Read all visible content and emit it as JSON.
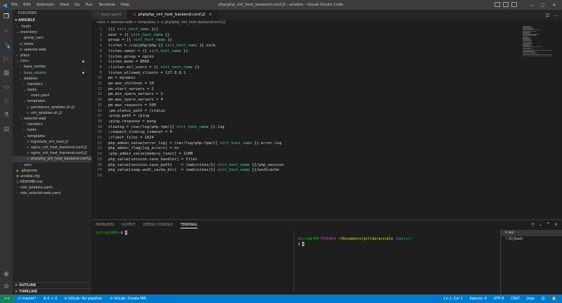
{
  "titlebar": {
    "menu": [
      "File",
      "Edit",
      "Selection",
      "View",
      "Go",
      "Run",
      "Terminal",
      "Help"
    ],
    "title": "php\\php_virt_host_backend.conf.j2 - ansible - Visual Studio Code"
  },
  "sidebar": {
    "title": "EXPLORER",
    "workspace": "ANSIBLE",
    "tree": [
      {
        "depth": 1,
        "chev": ">",
        "label": ".hosts"
      },
      {
        "depth": 1,
        "chev": "v",
        "label": "inventory"
      },
      {
        "depth": 2,
        "chev": ">",
        "label": "group_vars"
      },
      {
        "depth": 2,
        "chev": "",
        "label": "hosts",
        "icon": "≡"
      },
      {
        "depth": 2,
        "chev": "",
        "label": "selectel-web",
        "icon": "≡"
      },
      {
        "depth": 1,
        "chev": ">",
        "label": "plays"
      },
      {
        "depth": 1,
        "chev": "v",
        "label": "roles",
        "green": true,
        "dot": true
      },
      {
        "depth": 2,
        "chev": ">",
        "label": "base_centos"
      },
      {
        "depth": 2,
        "chev": ">",
        "label": "base_ubuntu",
        "green": true,
        "dot": true
      },
      {
        "depth": 2,
        "chev": "v",
        "label": "iptables"
      },
      {
        "depth": 3,
        "chev": ">",
        "label": "handlers"
      },
      {
        "depth": 3,
        "chev": "v",
        "label": "tasks"
      },
      {
        "depth": 4,
        "chev": "",
        "label": "main.yaml",
        "icon": "!",
        "iconcls": "c-yml"
      },
      {
        "depth": 3,
        "chev": "v",
        "label": "templates"
      },
      {
        "depth": 4,
        "chev": "",
        "label": "persitence_iptables.sh.j2",
        "icon": "≡",
        "iconcls": "c-j2"
      },
      {
        "depth": 4,
        "chev": "",
        "label": "virt_iptables.sh.j2",
        "icon": "≡",
        "iconcls": "c-j2"
      },
      {
        "depth": 2,
        "chev": "v",
        "label": "selectel-web"
      },
      {
        "depth": 3,
        "chev": ">",
        "label": "handlers"
      },
      {
        "depth": 3,
        "chev": ">",
        "label": "tasks"
      },
      {
        "depth": 3,
        "chev": "v",
        "label": "templates"
      },
      {
        "depth": 4,
        "chev": "",
        "label": "logrotate_virt_host.j2",
        "icon": "≡",
        "iconcls": "c-j2"
      },
      {
        "depth": 4,
        "chev": "",
        "label": "nginx_virt_host_backend.conf.j2",
        "icon": "≡",
        "iconcls": "c-j2"
      },
      {
        "depth": 4,
        "chev": "",
        "label": "nginx_virt_host_frontend.conf.j2",
        "icon": "≡",
        "iconcls": "c-j2"
      },
      {
        "depth": 4,
        "chev": "",
        "label": "php\\php_virt_host_backend.conf.j2",
        "icon": "≡",
        "iconcls": "c-j2",
        "selected": true
      },
      {
        "depth": 2,
        "chev": ">",
        "label": "vars"
      },
      {
        "depth": 1,
        "chev": "",
        "label": ".gitignore",
        "icon": "◆",
        "iconcls": "c-red"
      },
      {
        "depth": 1,
        "chev": "",
        "label": "ansible.cfg",
        "icon": "⚙"
      },
      {
        "depth": 1,
        "chev": "",
        "label": "README.md",
        "icon": "ⓘ"
      },
      {
        "depth": 1,
        "chev": "",
        "label": "role_iptables.yaml",
        "icon": "!",
        "iconcls": "c-yml"
      },
      {
        "depth": 1,
        "chev": "",
        "label": "role_selectel-web.yaml",
        "icon": "!",
        "iconcls": "c-yml"
      }
    ],
    "outline": "OUTLINE",
    "timeline": "TIMELINE"
  },
  "tabs": [
    {
      "label": "main.yaml",
      "icon": "!",
      "active": false
    },
    {
      "label": "php\\php_virt_host_backend.conf.j2",
      "icon": "≡",
      "active": true,
      "close": "×"
    }
  ],
  "breadcrumb": "roles > selectel-web > templates > ≡ php\\php_virt_host_backend.conf.j2",
  "editor": {
    "lines": [
      {
        "n": "1",
        "pre": "[{{ ",
        "var": "virt_host_name",
        "post": " }}]"
      },
      {
        "n": "2",
        "pre": "user = {{ ",
        "var": "virt_host_name",
        "post": " }}"
      },
      {
        "n": "3",
        "pre": "group = {{ ",
        "var": "virt_host_name",
        "post": " }}"
      },
      {
        "n": "4",
        "pre": "listen = /run/php/php-{{ ",
        "var": "virt_host_name",
        "post": " }}.sock"
      },
      {
        "n": "5",
        "pre": "listen.owner = {{ ",
        "var": "virt_host_name",
        "post": " }}"
      },
      {
        "n": "6",
        "pre": "listen.group = nginx",
        "var": "",
        "post": ""
      },
      {
        "n": "7",
        "pre": "listen.mode = 0660",
        "var": "",
        "post": ""
      },
      {
        "n": "8",
        "pre": ";listen.acl_users = {{ ",
        "var": "virt_host_name",
        "post": " }}"
      },
      {
        "n": "9",
        "pre": "listen.allowed_clients = 127.0.0.1",
        "var": "",
        "post": ""
      },
      {
        "n": "10",
        "pre": "pm = dynamic",
        "var": "",
        "post": ""
      },
      {
        "n": "11",
        "pre": "pm.max_children = 10",
        "var": "",
        "post": ""
      },
      {
        "n": "12",
        "pre": "pm.start_servers = 2",
        "var": "",
        "post": ""
      },
      {
        "n": "13",
        "pre": "pm.min_spare_servers = 2",
        "var": "",
        "post": ""
      },
      {
        "n": "14",
        "pre": "pm.max_spare_servers = 4",
        "var": "",
        "post": ""
      },
      {
        "n": "15",
        "pre": "pm.max_requests = 500",
        "var": "",
        "post": ""
      },
      {
        "n": "16",
        "pre": ";pm.status_path = /status",
        "var": "",
        "post": ""
      },
      {
        "n": "17",
        "pre": ";ping.path = /ping",
        "var": "",
        "post": ""
      },
      {
        "n": "18",
        "pre": ";ping.response = pong",
        "var": "",
        "post": ""
      },
      {
        "n": "19",
        "pre": "slowlog = /var/log/php-fpm/{{ ",
        "var": "virt_host_name",
        "post": " }}.log"
      },
      {
        "n": "20",
        "pre": ";request_slowlog_timeout = 0",
        "var": "",
        "post": ""
      },
      {
        "n": "21",
        "pre": ";rlimit_files = 1024",
        "var": "",
        "post": ""
      },
      {
        "n": "22",
        "pre": "php_admin_value[error_log] = /var/log/php-fpm/{{ ",
        "var": "virt_host_name",
        "post": " }}-error.log"
      },
      {
        "n": "23",
        "pre": "php_admin_flag[log_errors] = on",
        "var": "",
        "post": ""
      },
      {
        "n": "24",
        "pre": ";php_admin_value[memory_limit] = 128M",
        "var": "",
        "post": ""
      },
      {
        "n": "25",
        "pre": "php_value[session.save_handler] = files",
        "var": "",
        "post": ""
      },
      {
        "n": "26",
        "pre": "php_value[session.save_path]    = /web/sites/{{ ",
        "var": "virt_host_name",
        "post": " }}/php_session"
      },
      {
        "n": "27",
        "pre": "php_value[soap.wsdl_cache_dir]  = /web/sites/{{ ",
        "var": "virt_host_name",
        "post": " }}/wsdlcache"
      },
      {
        "n": "28",
        "pre": "",
        "var": "",
        "post": ""
      }
    ]
  },
  "panel": {
    "tabs": [
      "PROBLEMS",
      "OUTPUT",
      "DEBUG CONSOLE",
      "TERMINAL"
    ],
    "active_tab": "TERMINAL",
    "term_left": {
      "user": "zorro@1400",
      "rest": ":~$ "
    },
    "term_right": {
      "user": "Zorro@1400",
      "host": " MINGW64 ",
      "path": "~/Documents/gitlab/ansible",
      "branch": " (master)",
      "prompt": "$ "
    },
    "terminals": [
      {
        "label": "wsl",
        "icon": "⌷"
      },
      {
        "label": "[2] bash",
        "icon": "└"
      }
    ]
  },
  "statusbar": {
    "remote": "><",
    "left": [
      "⎇ master*",
      "⊗ 0 ⚠ 0",
      "⊙ GitLab: No pipeline.",
      "⊙ GitLab: Create MR."
    ],
    "right": [
      "Ln 1, Col 1",
      "Spaces: 4",
      "UTF-8",
      "CRLF",
      "Jinja",
      "☺",
      "🔔"
    ]
  }
}
